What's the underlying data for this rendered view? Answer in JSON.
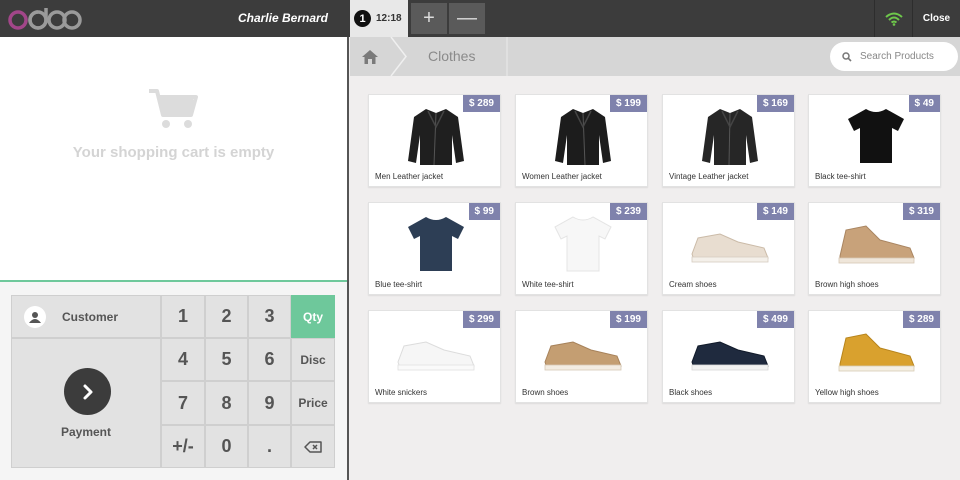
{
  "topbar": {
    "cashier": "Charlie Bernard",
    "order_number": "1",
    "order_time": "12:18",
    "add_order": "+",
    "remove_order": "—",
    "close_label": "Close"
  },
  "cart": {
    "empty_message": "Your shopping cart is empty"
  },
  "numpad": {
    "customer_label": "Customer",
    "payment_label": "Payment",
    "keys": [
      "1",
      "2",
      "3",
      "4",
      "5",
      "6",
      "7",
      "8",
      "9",
      "+/-",
      "0",
      "."
    ],
    "mode_qty": "Qty",
    "mode_disc": "Disc",
    "mode_price": "Price"
  },
  "breadcrumb": {
    "category": "Clothes"
  },
  "search": {
    "placeholder": "Search Products"
  },
  "products": [
    {
      "name": "Men Leather jacket",
      "price": "$ 289",
      "icon": "black-leather-jacket-icon"
    },
    {
      "name": "Women Leather jacket",
      "price": "$ 199",
      "icon": "black-leather-jacket-icon"
    },
    {
      "name": "Vintage Leather jacket",
      "price": "$ 169",
      "icon": "black-leather-jacket-icon"
    },
    {
      "name": "Black tee-shirt",
      "price": "$ 49",
      "icon": "black-tshirt-icon"
    },
    {
      "name": "Blue tee-shirt",
      "price": "$ 99",
      "icon": "blue-tshirt-icon"
    },
    {
      "name": "White tee-shirt",
      "price": "$ 239",
      "icon": "white-tshirt-icon"
    },
    {
      "name": "Cream shoes",
      "price": "$ 149",
      "icon": "cream-sneaker-icon"
    },
    {
      "name": "Brown high shoes",
      "price": "$ 319",
      "icon": "brown-high-shoe-icon"
    },
    {
      "name": "White snickers",
      "price": "$ 299",
      "icon": "white-sneaker-icon"
    },
    {
      "name": "Brown shoes",
      "price": "$ 199",
      "icon": "brown-sneaker-icon"
    },
    {
      "name": "Black shoes",
      "price": "$ 499",
      "icon": "black-sneaker-icon"
    },
    {
      "name": "Yellow high shoes",
      "price": "$ 289",
      "icon": "yellow-high-shoe-icon"
    }
  ],
  "colors": {
    "accent": "#6ec89b",
    "price_tag": "#7f82ac",
    "topbar": "#3c3c3c",
    "logo_o": "#875a7b"
  }
}
